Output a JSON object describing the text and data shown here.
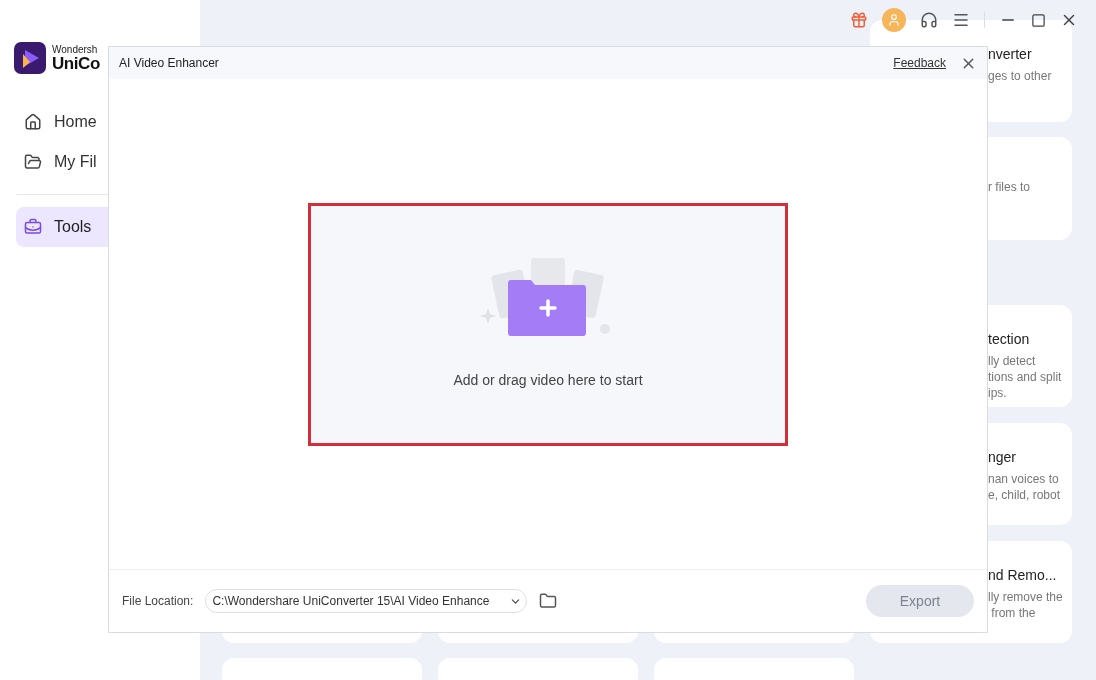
{
  "brand": {
    "line1": "Wondersh",
    "line2": "UniCo"
  },
  "nav": [
    {
      "label": "Home",
      "selected": false
    },
    {
      "label": "My Fil",
      "selected": false
    },
    {
      "label": "Tools",
      "selected": true
    }
  ],
  "background_cards": [
    {
      "title": "nverter",
      "description": "ges to other"
    },
    {
      "description": "r files to"
    },
    {
      "title": "tection",
      "description": "lly detect\ntions and split\nips."
    },
    {
      "title": "nger",
      "description": "nan voices to\ne, child, robot"
    },
    {
      "title": "nd Remo...",
      "description": "lly remove the\n from the"
    }
  ],
  "dialog": {
    "title": "AI Video Enhancer",
    "feedback": "Feedback",
    "dropzone_text": "Add or drag video here to start",
    "file_location_label": "File Location:",
    "file_location_value": "C:\\Wondershare UniConverter 15\\AI Video Enhance",
    "export": {
      "label": "Export",
      "disabled": true
    }
  }
}
